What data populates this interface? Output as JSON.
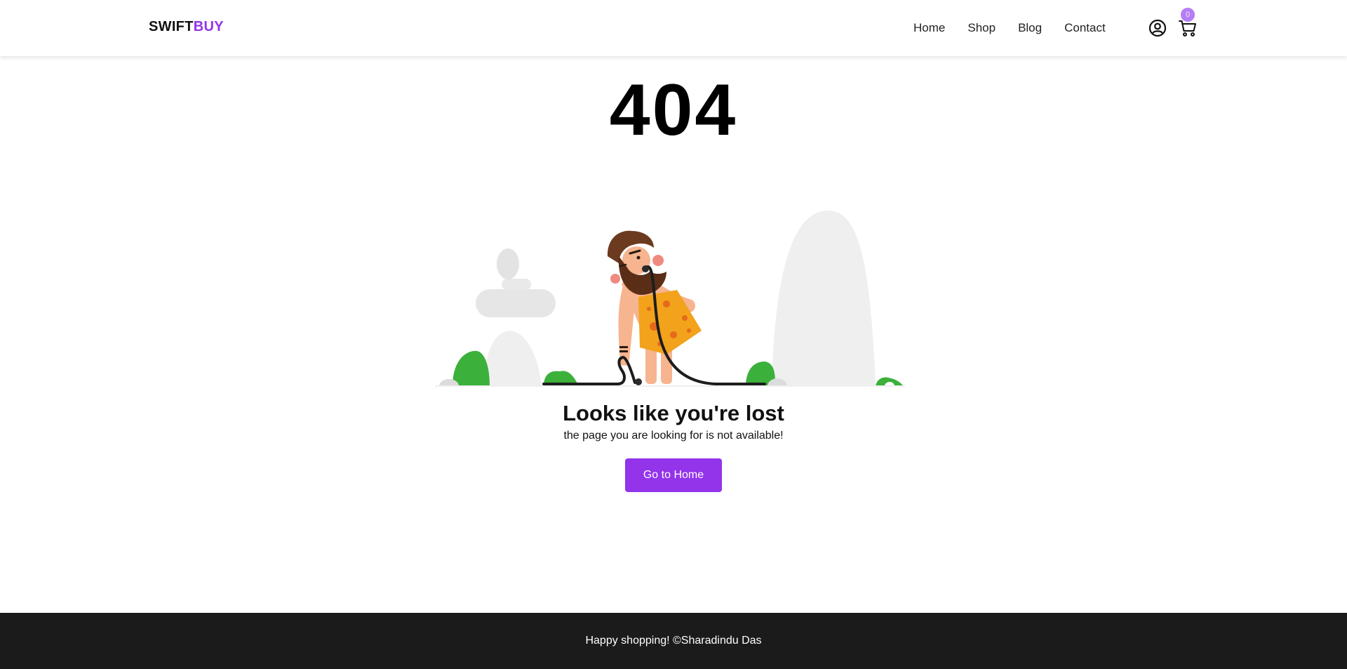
{
  "header": {
    "logo_part1": "SWIFT",
    "logo_part2": "BUY",
    "nav": [
      "Home",
      "Shop",
      "Blog",
      "Contact"
    ],
    "cart_count": "0",
    "icons": {
      "account": "user-circle-icon",
      "cart": "cart-icon"
    }
  },
  "main": {
    "error_code": "404",
    "title": "Looks like you're lost",
    "subtitle": "the page you are looking for is not available!",
    "button_label": "Go to Home"
  },
  "footer": {
    "text": "Happy shopping! ©Sharadindu Das"
  },
  "colors": {
    "accent": "#9333ea",
    "badge": "#b57ef5",
    "footer_bg": "#1b1b1b"
  }
}
